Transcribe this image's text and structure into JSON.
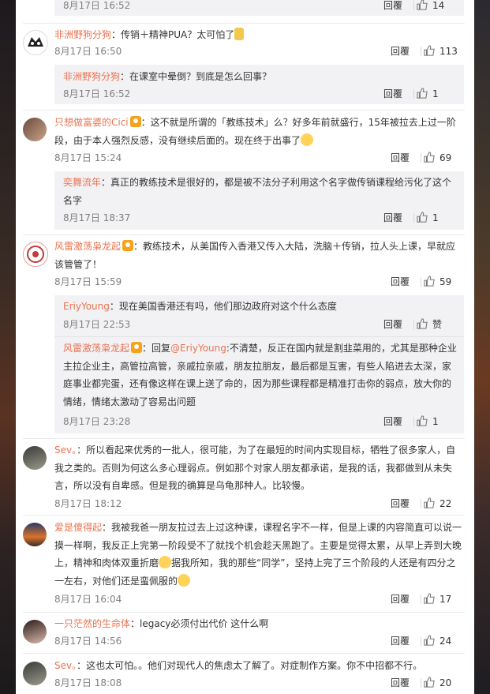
{
  "colors": {
    "username": "#eb7350",
    "date": "#808080",
    "subbox": "#f2f2f5"
  },
  "reply_label": "回覆",
  "comments": [
    {
      "date": "8月17日 16:52",
      "likes": "14"
    },
    {
      "user": "非洲野狗分狗",
      "text": "：传销＋精神PUA？太可怕了",
      "date": "8月17日 16:50",
      "likes": "113",
      "reply": {
        "user": "非洲野狗分狗",
        "text": "：在课室中晕倒？到底是怎么回事？",
        "date": "8月17日 16:52",
        "likes": "1"
      }
    },
    {
      "user": "只想做富婆的Cici",
      "text": "：这不就是所谓的「教练技术」么？好多年前就盛行，15年被拉去上过一阶段，由于本人强烈反感，没有继续后面的。现在终于出事了",
      "date": "8月17日 15:24",
      "likes": "69",
      "reply": {
        "user": "奕舞流年",
        "text": "：真正的教练技术是很好的，都是被不法分子利用这个名字做传销课程给污化了这个名字",
        "date": "8月17日 18:37",
        "likes": "1"
      }
    },
    {
      "user": "风雷激荡枭龙起",
      "text": "：教练技术，从美国传入香港又传入大陆，洗脑＋传销，拉人头上课，早就应该管管了！",
      "date": "8月17日 15:59",
      "likes": "59",
      "reply": {
        "user": "EriyYoung",
        "text": "：现在美国香港还有吗，他们那边政府对这个什么态度",
        "date": "8月17日 22:53",
        "likes": "赞"
      },
      "reply2": {
        "user": "风雷激荡枭龙起",
        "prefix": "：回复",
        "mention": "@EriyYoung",
        "text": ":不清楚，反正在国内就是割韭菜用的，尤其是那种企业主拉企业主，高管拉高管，亲戚拉亲戚，朋友拉朋友，最后都是互害，有些人陷进去太深，家庭事业都完蛋，还有像这样在课上送了命的，因为那些课程都是精准打击你的弱点，放大你的情绪，情绪太激动了容易出问题",
        "date": "8月17日 23:28",
        "likes": "1"
      }
    },
    {
      "user": "Sev。",
      "text": "：所以看起来优秀的一批人，很可能，为了在最短的时间内实现目标，牺牲了很多家人，自我之类的。否则为何这么多心理弱点。例如那个对家人朋友都承诺，是我的话，我都做到从未失言，所以没有自卑感。但是我的确算是乌龟那种人。比较慢。",
      "date": "8月17日 18:12",
      "likes": "22"
    },
    {
      "user": "爱是傻得起",
      "text1": "：我被我爸一朋友拉过去上过这种课，课程名字不一样，但是上课的内容简直可以说一摸一样啊，我反正上完第一阶段受不了就找个机会趁天黑跑了。主要是觉得太累，从早上弄到大晚上，精神和肉体双重折磨",
      "text2": "据我所知，我的那些“同学”，坚持上完了三个阶段的人还是有四分之一左右，对他们还是蛮佩服的",
      "date": "8月17日 16:04",
      "likes": "17"
    },
    {
      "user": "一只茫然的生命体",
      "text": "：legacy必须付出代价 这什么啊",
      "date": "8月17日 14:56",
      "likes": "24"
    },
    {
      "user": "Sev。",
      "text": "：这也太可怕。。他们对现代人的焦虑太了解了。对症制作方案。你不中招都不行。",
      "date": "8月17日 18:08",
      "likes": "20"
    }
  ]
}
